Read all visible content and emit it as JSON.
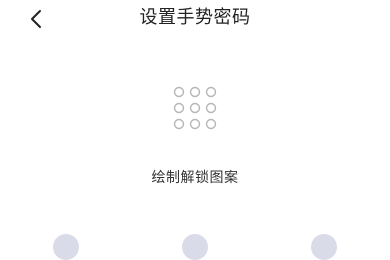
{
  "header": {
    "title": "设置手势密码",
    "back_icon": "chevron-left-icon"
  },
  "preview": {
    "icon": "pattern-preview-grid",
    "rows": 3,
    "cols": 3,
    "dot_color": "#b5b5b5"
  },
  "hint": {
    "text": "绘制解锁图案"
  },
  "pattern_pad": {
    "dot_color": "#d9dbe8",
    "visible_dots": 3
  }
}
